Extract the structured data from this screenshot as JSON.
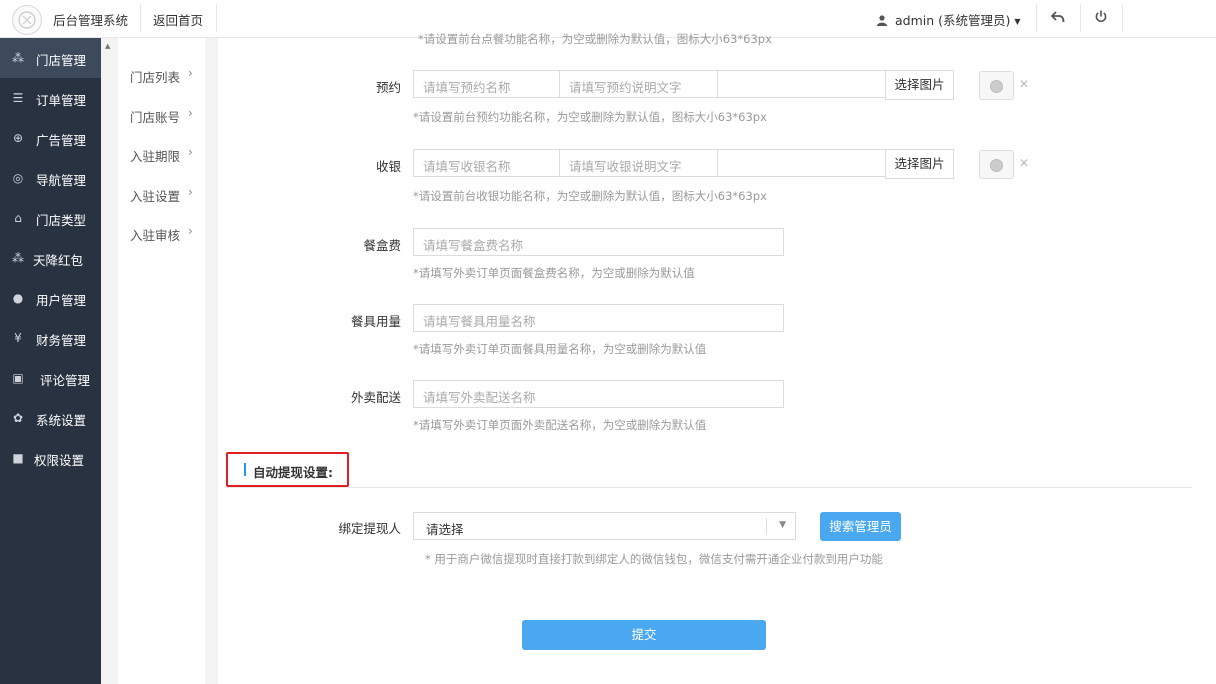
{
  "header": {
    "app_title": "后台管理系统",
    "home_link": "返回首页",
    "user_label": "admin (系统管理员)"
  },
  "sidebar": {
    "items": [
      {
        "label": "门店管理",
        "icon": "cubes-icon",
        "glyph": "⁂",
        "active": true
      },
      {
        "label": "订单管理",
        "icon": "list-icon",
        "glyph": "☰"
      },
      {
        "label": "广告管理",
        "icon": "lifebuoy-icon",
        "glyph": "⊕"
      },
      {
        "label": "导航管理",
        "icon": "compass-icon",
        "glyph": "◎"
      },
      {
        "label": "门店类型",
        "icon": "bank-icon",
        "glyph": "⌂"
      },
      {
        "label": "天降红包",
        "icon": "cubes-icon",
        "glyph": "⁂"
      },
      {
        "label": "用户管理",
        "icon": "user-icon",
        "glyph": "●"
      },
      {
        "label": "财务管理",
        "icon": "yen-icon",
        "glyph": "¥"
      },
      {
        "label": "评论管理",
        "icon": "money-icon",
        "glyph": "▣"
      },
      {
        "label": "系统设置",
        "icon": "gear-icon",
        "glyph": "✿"
      },
      {
        "label": "权限设置",
        "icon": "lock-icon",
        "glyph": "■"
      }
    ]
  },
  "subnav": {
    "items": [
      {
        "label": "门店列表"
      },
      {
        "label": "门店账号"
      },
      {
        "label": "入驻期限"
      },
      {
        "label": "入驻设置"
      },
      {
        "label": "入驻审核"
      }
    ]
  },
  "form": {
    "top_hint": "*请设置前台点餐功能名称，为空或删除为默认值，图标大小63*63px",
    "booking": {
      "label": "预约",
      "name_placeholder": "请填写预约名称",
      "desc_placeholder": "请填写预约说明文字",
      "button": "选择图片",
      "hint": "*请设置前台预约功能名称，为空或删除为默认值，图标大小63*63px"
    },
    "cashier": {
      "label": "收银",
      "name_placeholder": "请填写收银名称",
      "desc_placeholder": "请填写收银说明文字",
      "button": "选择图片",
      "hint": "*请设置前台收银功能名称，为空或删除为默认值，图标大小63*63px"
    },
    "box_fee": {
      "label": "餐盒费",
      "placeholder": "请填写餐盒费名称",
      "hint": "*请填写外卖订单页面餐盒费名称，为空或删除为默认值"
    },
    "tableware": {
      "label": "餐具用量",
      "placeholder": "请填写餐具用量名称",
      "hint": "*请填写外卖订单页面餐具用量名称，为空或删除为默认值"
    },
    "delivery": {
      "label": "外卖配送",
      "placeholder": "请填写外卖配送名称",
      "hint": "*请填写外卖订单页面外卖配送名称，为空或删除为默认值"
    },
    "auto_withdraw": {
      "title": "自动提现设置:",
      "bind_label": "绑定提现人",
      "select_value": "请选择",
      "search_button": "搜索管理员",
      "hint": "* 用于商户微信提现时直接打款到绑定人的微信钱包，微信支付需开通企业付款到用户功能"
    },
    "submit": "提交"
  },
  "colors": {
    "sidebar_bg": "#293241",
    "sidebar_active": "#3c4a5b",
    "accent_blue": "#4aa8f0",
    "highlight_red": "#e02020"
  }
}
